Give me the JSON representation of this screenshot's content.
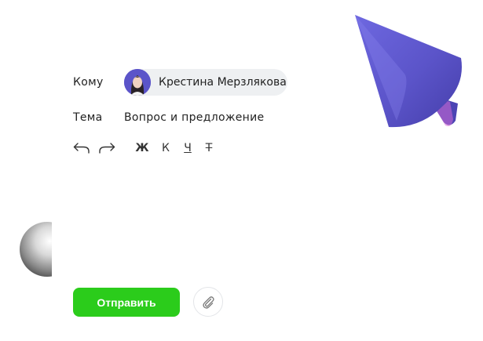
{
  "compose": {
    "to_label": "Кому",
    "recipient_name": "Крестина Мерзлякова",
    "subject_label": "Тема",
    "subject_value": "Вопрос и предложение"
  },
  "toolbar": {
    "undo_icon": "undo-icon",
    "redo_icon": "redo-icon",
    "bold_label": "Ж",
    "italic_label": "К",
    "underline_label": "Ч",
    "strike_label": "Т"
  },
  "actions": {
    "send_label": "Отправить",
    "attach_icon": "paperclip-icon"
  },
  "colors": {
    "accent": "#2bcc1b",
    "chip_bg": "#eef0f2",
    "cone": "#5b54c9"
  }
}
